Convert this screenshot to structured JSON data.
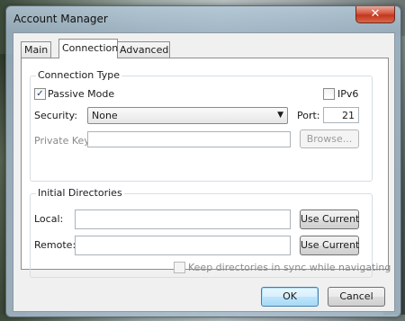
{
  "window": {
    "title": "Account Manager",
    "close_label": "✕"
  },
  "tabs": [
    {
      "label": "Main"
    },
    {
      "label": "Connection"
    },
    {
      "label": "Advanced"
    }
  ],
  "connection_type": {
    "title": "Connection Type",
    "passive_mode": {
      "label": "Passive Mode",
      "checked": true
    },
    "ipv6": {
      "label": "IPv6",
      "checked": false
    },
    "security": {
      "label": "Security:",
      "value": "None"
    },
    "port": {
      "label": "Port:",
      "value": "21"
    },
    "private_key": {
      "label": "Private Key:",
      "value": "",
      "browse_label": "Browse..."
    }
  },
  "initial_directories": {
    "title": "Initial Directories",
    "local": {
      "label": "Local:",
      "value": "",
      "button_label": "Use Current"
    },
    "remote": {
      "label": "Remote:",
      "value": "",
      "button_label": "Use Current"
    },
    "sync": {
      "label": "Keep directories in sync while navigating",
      "checked": false
    }
  },
  "footer": {
    "ok_label": "OK",
    "cancel_label": "Cancel"
  },
  "icons": {
    "checkmark": "check-icon",
    "dropdown": "chevron-down-icon",
    "close": "close-icon"
  }
}
